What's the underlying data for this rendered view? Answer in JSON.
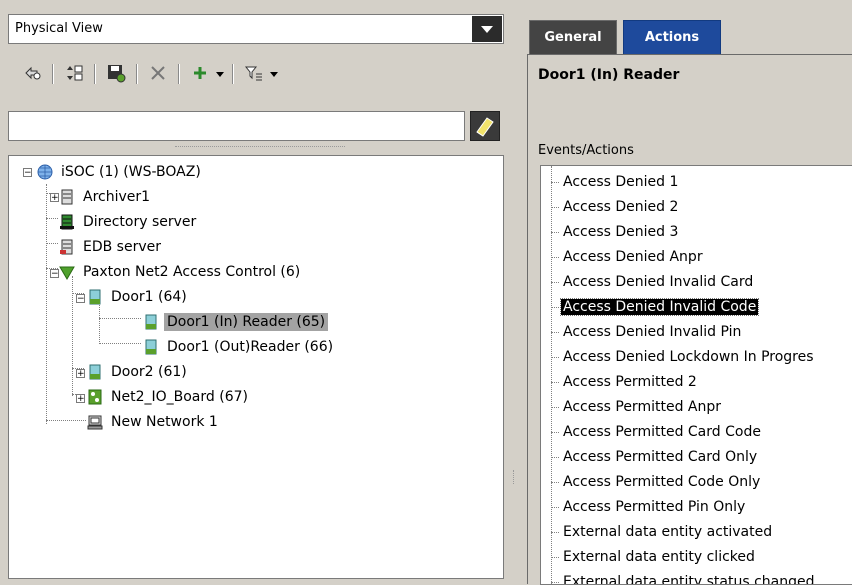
{
  "left_panel": {
    "view_select": {
      "value": "Physical View"
    },
    "toolbar": {
      "icons": [
        "navigate-icon",
        "sort-icon",
        "save-icon",
        "delete-icon",
        "add-icon",
        "filter-icon"
      ]
    },
    "search": {
      "value": ""
    },
    "tree": [
      {
        "label": "iSOC (1) (WS-BOAZ)",
        "icon": "globe-icon"
      },
      {
        "label": "Archiver1",
        "icon": "server-icon"
      },
      {
        "label": "Directory server",
        "icon": "directory-server-icon"
      },
      {
        "label": "EDB server",
        "icon": "edb-server-icon"
      },
      {
        "label": "Paxton Net2 Access Control (6)",
        "icon": "access-control-icon"
      },
      {
        "label": "Door1 (64)",
        "icon": "door-icon"
      },
      {
        "label": "Door1 (In) Reader (65)",
        "icon": "door-icon",
        "selected": true
      },
      {
        "label": "Door1 (Out)Reader (66)",
        "icon": "door-icon"
      },
      {
        "label": "Door2 (61)",
        "icon": "door-icon"
      },
      {
        "label": "Net2_IO_Board (67)",
        "icon": "io-board-icon"
      },
      {
        "label": "New Network 1",
        "icon": "network-icon"
      }
    ]
  },
  "right_panel": {
    "tabs": [
      {
        "label": "General",
        "active": false
      },
      {
        "label": "Actions",
        "active": true
      }
    ],
    "title": "Door1 (In) Reader",
    "events_label": "Events/Actions",
    "events": [
      "Access Denied 1",
      "Access Denied 2",
      "Access Denied 3",
      "Access Denied Anpr",
      "Access Denied Invalid Card",
      "Access Denied Invalid Code",
      "Access Denied Invalid Pin",
      "Access Denied Lockdown In Progres",
      "Access Permitted 2",
      "Access Permitted Anpr",
      "Access Permitted Card Code",
      "Access Permitted Card Only",
      "Access Permitted Code Only",
      "Access Permitted Pin Only",
      "External data entity activated",
      "External data entity clicked",
      "External data entity status changed"
    ],
    "selected_event": "Access Denied Invalid Code"
  },
  "colors": {
    "actions_tab": "#1e4a9c",
    "general_tab": "#444444",
    "selection_tree": "#a3a3a3"
  }
}
